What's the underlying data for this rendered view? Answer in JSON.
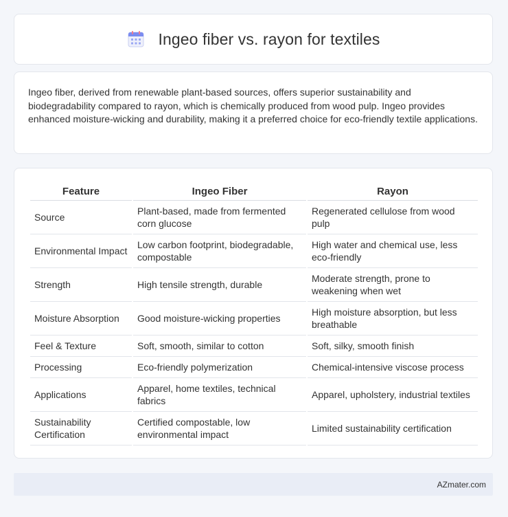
{
  "header": {
    "title": "Ingeo fiber vs. rayon for textiles",
    "icon": "calendar-icon"
  },
  "summary": {
    "text": "Ingeo fiber, derived from renewable plant-based sources, offers superior sustainability and biodegradability compared to rayon, which is chemically produced from wood pulp. Ingeo provides enhanced moisture-wicking and durability, making it a preferred choice for eco-friendly textile applications."
  },
  "table": {
    "headers": [
      "Feature",
      "Ingeo Fiber",
      "Rayon"
    ],
    "rows": [
      [
        "Source",
        "Plant-based, made from fermented corn glucose",
        "Regenerated cellulose from wood pulp"
      ],
      [
        "Environmental Impact",
        "Low carbon footprint, biodegradable, compostable",
        "High water and chemical use, less eco-friendly"
      ],
      [
        "Strength",
        "High tensile strength, durable",
        "Moderate strength, prone to weakening when wet"
      ],
      [
        "Moisture Absorption",
        "Good moisture-wicking properties",
        "High moisture absorption, but less breathable"
      ],
      [
        "Feel & Texture",
        "Soft, smooth, similar to cotton",
        "Soft, silky, smooth finish"
      ],
      [
        "Processing",
        "Eco-friendly polymerization",
        "Chemical-intensive viscose process"
      ],
      [
        "Applications",
        "Apparel, home textiles, technical fabrics",
        "Apparel, upholstery, industrial textiles"
      ],
      [
        "Sustainability Certification",
        "Certified compostable, low environmental impact",
        "Limited sustainability certification"
      ]
    ]
  },
  "footer": {
    "brand": "AZmater.com"
  },
  "colors": {
    "page_background": "#f4f6fa",
    "card_background": "#ffffff",
    "footer_background": "#e9edf6",
    "icon_accent": "#7b8cf0"
  }
}
